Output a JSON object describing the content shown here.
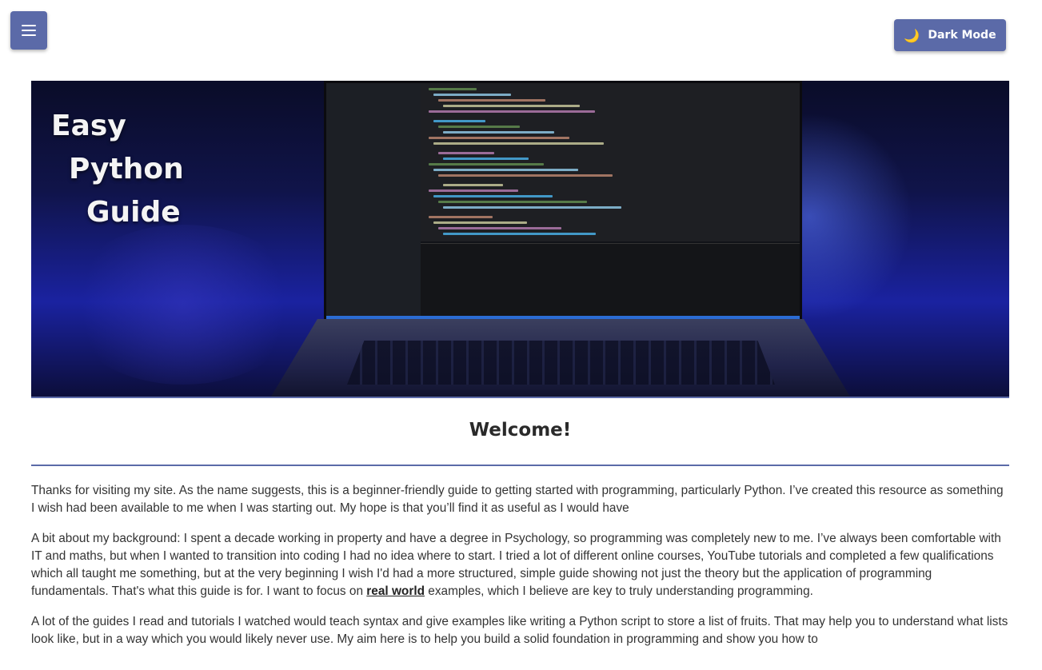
{
  "header": {
    "menu_icon": "hamburger-menu-icon",
    "dark_mode_icon": "moon-icon",
    "dark_mode_label": "Dark Mode"
  },
  "hero": {
    "title_lines": [
      "Easy",
      "Python",
      "Guide"
    ]
  },
  "main": {
    "heading": "Welcome!",
    "paragraphs": [
      {
        "text": "Thanks for visiting my site. As the name suggests, this is a beginner-friendly guide to getting started with programming, particularly Python. I’ve created this resource as something I wish had been available to me when I was starting out. My hope is that you’ll find it as useful as I would have"
      },
      {
        "before": "A bit about my background: I spent a decade working in property and have a degree in Psychology, so programming was completely new to me. I’ve always been comfortable with IT and maths, but when I wanted to transition into coding I had no idea where to start. I tried a lot of different online courses, YouTube tutorials and completed a few qualifications which all taught me something, but at the very beginning I wish I'd had a more structured, simple guide showing not just the theory but the application of programming fundamentals. That's what this guide is for. I want to focus on ",
        "link": "real world",
        "after": " examples, which I believe are key to truly understanding programming."
      },
      {
        "text": "A lot of the guides I read and tutorials I watched would teach syntax and give examples like writing a Python script to store a list of fruits. That may help you to understand what lists look like, but in a way which you would likely never use. My aim here is to help you build a solid foundation in programming and show you how to"
      }
    ]
  },
  "colors": {
    "accent": "#5b6aa8",
    "moon": "#f5c542"
  }
}
